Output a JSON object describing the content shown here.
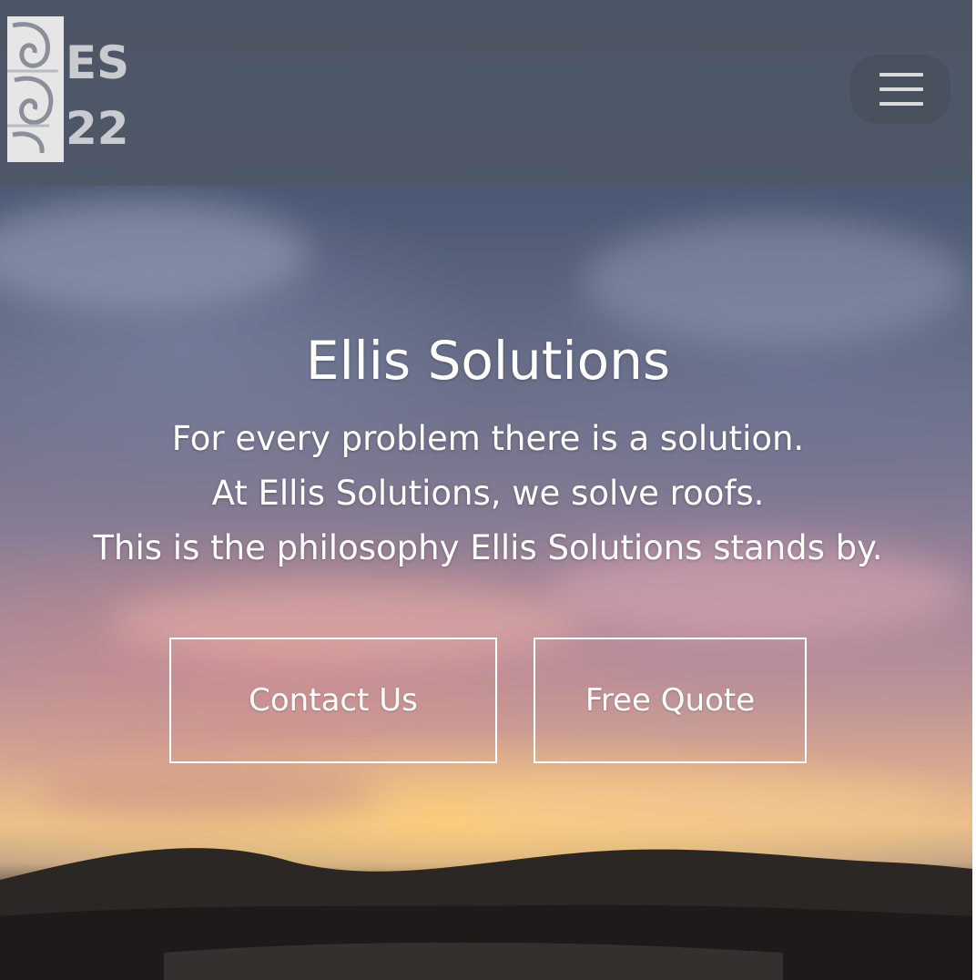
{
  "header": {
    "logo_text_top": "ES",
    "logo_text_bottom": "22",
    "menu_icon": "hamburger-menu-icon"
  },
  "hero": {
    "title": "Ellis Solutions",
    "tagline": [
      "For every problem there is a solution.",
      "At Ellis Solutions, we solve roofs.",
      "This is the philosophy Ellis Solutions stands by."
    ],
    "buttons": {
      "contact_label": "Contact Us",
      "quote_label": "Free Quote"
    }
  },
  "colors": {
    "text": "#ffffff",
    "header_bg": "#505866",
    "button_border": "#ffffff"
  }
}
